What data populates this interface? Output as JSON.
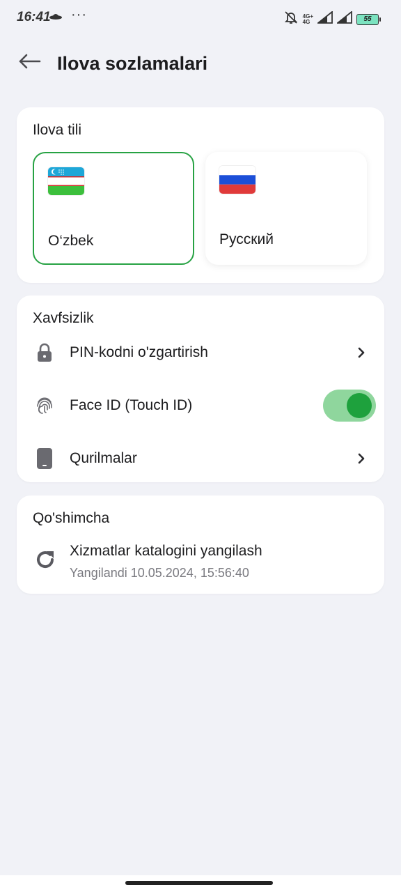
{
  "status_bar": {
    "time": "16:41",
    "dots": "···",
    "network_label_top": "4G+",
    "network_label_bottom": "4G",
    "battery": "55"
  },
  "header": {
    "title": "Ilova sozlamalari",
    "back_icon": "arrow-left-icon"
  },
  "language": {
    "title": "Ilova tili",
    "options": [
      {
        "name": "O‘zbek",
        "flag": "uzbekistan-flag",
        "selected": true
      },
      {
        "name": "Русский",
        "flag": "russia-flag",
        "selected": false
      }
    ]
  },
  "security": {
    "title": "Xavfsizlik",
    "items": [
      {
        "label": "PIN-kodni o'zgartirish",
        "icon": "lock-icon",
        "action": "chevron"
      },
      {
        "label": "Face ID (Touch ID)",
        "icon": "fingerprint-icon",
        "action": "toggle",
        "enabled": true
      },
      {
        "label": "Qurilmalar",
        "icon": "phone-icon",
        "action": "chevron"
      }
    ]
  },
  "extra": {
    "title": "Qo'shimcha",
    "refresh": {
      "title": "Xizmatlar katalogini yangilash",
      "subtitle": "Yangilandi 10.05.2024, 15:56:40",
      "icon": "refresh-icon"
    }
  },
  "colors": {
    "background": "#f1f2f7",
    "accent": "#1ea13d",
    "toggle_track": "#8fd69d",
    "selected_border": "#27a243"
  }
}
